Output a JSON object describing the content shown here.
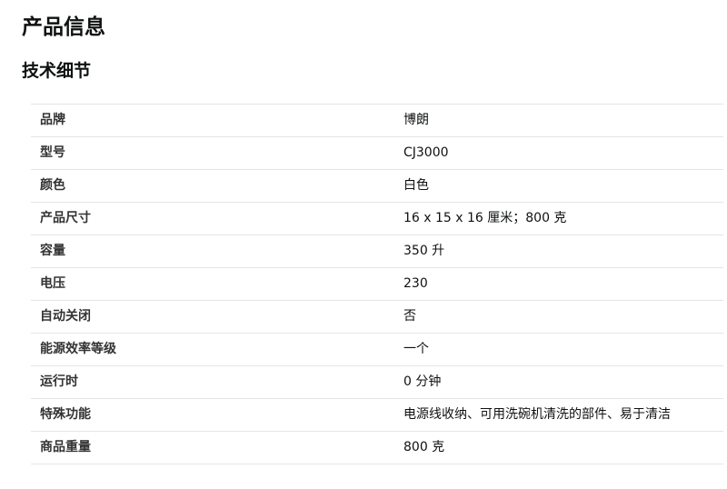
{
  "page": {
    "title": "产品信息",
    "section_title": "技术细节"
  },
  "specs": [
    {
      "label": "品牌",
      "value": "博朗"
    },
    {
      "label": "型号",
      "value": "CJ3000"
    },
    {
      "label": "颜色",
      "value": "白色"
    },
    {
      "label": "产品尺寸",
      "value": "16 x 15 x 16 厘米；800 克"
    },
    {
      "label": "容量",
      "value": "350 升"
    },
    {
      "label": "电压",
      "value": "230"
    },
    {
      "label": "自动关闭",
      "value": "否"
    },
    {
      "label": "能源效率等级",
      "value": "一个"
    },
    {
      "label": "运行时",
      "value": "0 分钟"
    },
    {
      "label": "特殊功能",
      "value": "电源线收纳、可用洗碗机清洗的部件、易于清洁"
    },
    {
      "label": "商品重量",
      "value": "800 克"
    }
  ]
}
